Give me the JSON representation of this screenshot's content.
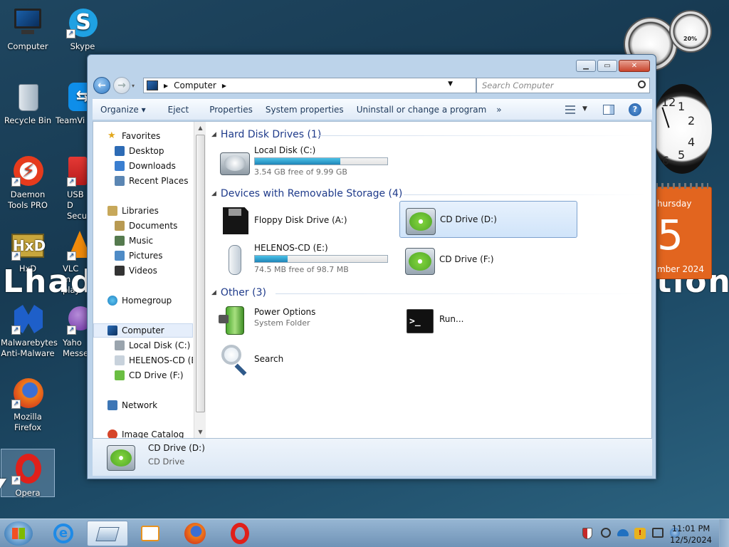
{
  "desktop": {
    "icons": [
      {
        "label": "Computer"
      },
      {
        "label": "Skype"
      },
      {
        "label": "Recycle Bin"
      },
      {
        "label": "TeamVi"
      },
      {
        "label": "Daemon Tools PRO"
      },
      {
        "label": "USB D Secu"
      },
      {
        "label": "HxD"
      },
      {
        "label": "VLC m play"
      },
      {
        "label": "Malwarebytes Anti-Malware"
      },
      {
        "label": "Yaho Messe"
      },
      {
        "label": "Mozilla Firefox"
      },
      {
        "label": "Opera"
      }
    ],
    "watermark_left": "Lhad",
    "watermark_right": "ition"
  },
  "gadgets": {
    "cpu_meter_value": "20%",
    "calendar_day_name": "hursday",
    "calendar_day": "5",
    "calendar_month_year": "mber 2024",
    "clock_numbers": [
      "12",
      "1",
      "2",
      "4",
      "5",
      "6"
    ]
  },
  "window": {
    "address_path": "Computer",
    "search_placeholder": "Search Computer",
    "toolbar": {
      "organize": "Organize",
      "eject": "Eject",
      "properties": "Properties",
      "system_properties": "System properties",
      "uninstall": "Uninstall or change a program",
      "more": "»"
    },
    "nav_pane": {
      "favorites": "Favorites",
      "desktop": "Desktop",
      "downloads": "Downloads",
      "recent_places": "Recent Places",
      "libraries": "Libraries",
      "documents": "Documents",
      "music": "Music",
      "pictures": "Pictures",
      "videos": "Videos",
      "homegroup": "Homegroup",
      "computer": "Computer",
      "local_disk": "Local Disk (C:)",
      "helenos": "HELENOS-CD (E:",
      "cd_drive_f": "CD Drive (F:)",
      "network": "Network",
      "image_catalog": "Image Catalog"
    },
    "groups": {
      "hard_disk": "Hard Disk Drives (1)",
      "removable": "Devices with Removable Storage (4)",
      "other": "Other (3)"
    },
    "items": {
      "local_disk": {
        "name": "Local Disk (C:)",
        "free": "3.54 GB free of 9.99 GB",
        "used_fraction": 0.646
      },
      "floppy": {
        "name": "Floppy Disk Drive (A:)"
      },
      "cd_d": {
        "name": "CD Drive (D:)"
      },
      "helenos": {
        "name": "HELENOS-CD (E:)",
        "free": "74.5 MB free of 98.7 MB",
        "used_fraction": 0.245
      },
      "cd_f": {
        "name": "CD Drive (F:)"
      },
      "power": {
        "name": "Power Options",
        "sub": "System Folder"
      },
      "run": {
        "name": "Run..."
      },
      "search": {
        "name": "Search"
      }
    },
    "details": {
      "name": "CD Drive (D:)",
      "type": "CD Drive"
    }
  },
  "taskbar": {
    "time": "11:01 PM",
    "date": "12/5/2024"
  },
  "colors": {
    "bar_fill": "#1f85b8",
    "group_header": "#1e3a8a",
    "selection": "#d0e4fa"
  }
}
